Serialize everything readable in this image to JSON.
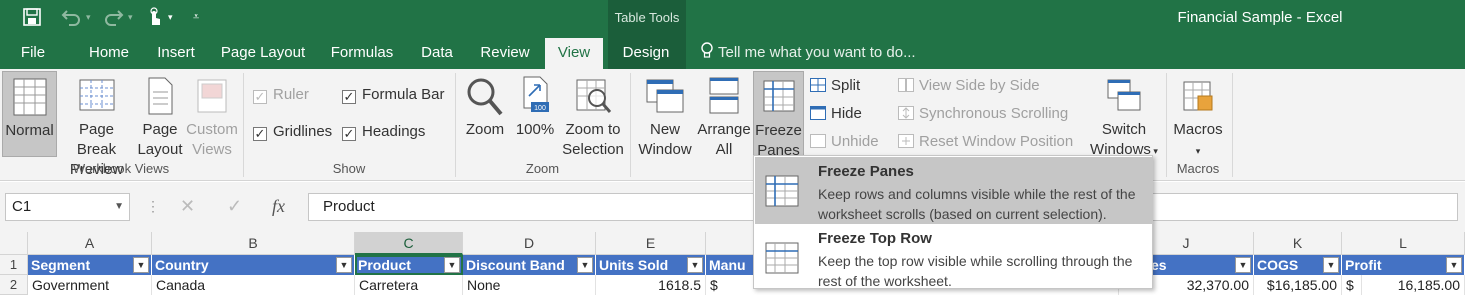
{
  "window": {
    "title": "Financial Sample - Excel",
    "contextual_group": "Table Tools"
  },
  "qat": {
    "save_icon": "save-icon",
    "undo_icon": "undo-icon",
    "redo_icon": "redo-icon",
    "touch_icon": "touch-mode-icon",
    "customize_icon": "customize-qat-icon"
  },
  "tabs": [
    {
      "label": "File"
    },
    {
      "label": "Home"
    },
    {
      "label": "Insert"
    },
    {
      "label": "Page Layout"
    },
    {
      "label": "Formulas"
    },
    {
      "label": "Data"
    },
    {
      "label": "Review"
    },
    {
      "label": "View"
    },
    {
      "label": "Design"
    }
  ],
  "tell_me": "Tell me what you want to do...",
  "ribbon": {
    "workbook_views": {
      "label": "Workbook Views",
      "normal": "Normal",
      "page_break_1": "Page Break",
      "page_break_2": "Preview",
      "page_layout_1": "Page",
      "page_layout_2": "Layout",
      "custom_1": "Custom",
      "custom_2": "Views"
    },
    "show": {
      "label": "Show",
      "ruler": "Ruler",
      "formula_bar": "Formula Bar",
      "gridlines": "Gridlines",
      "headings": "Headings",
      "ruler_checked": true,
      "formula_bar_checked": true,
      "gridlines_checked": true,
      "headings_checked": true
    },
    "zoom": {
      "label": "Zoom",
      "zoom": "Zoom",
      "zoom100": "100%",
      "zts_1": "Zoom to",
      "zts_2": "Selection"
    },
    "window": {
      "new_1": "New",
      "new_2": "Window",
      "arrange_1": "Arrange",
      "arrange_2": "All",
      "freeze_1": "Freeze",
      "freeze_2": "Panes",
      "split": "Split",
      "hide": "Hide",
      "unhide": "Unhide",
      "side_by_side": "View Side by Side",
      "sync_scroll": "Synchronous Scrolling",
      "reset_pos": "Reset Window Position",
      "switch_1": "Switch",
      "switch_2": "Windows"
    },
    "macros": {
      "label": "Macros",
      "macros": "Macros"
    }
  },
  "formula_bar": {
    "name_box": "C1",
    "cancel": "✕",
    "enter": "✓",
    "fx": "fx",
    "content": "Product"
  },
  "columns": [
    "A",
    "B",
    "C",
    "D",
    "E",
    "J",
    "K",
    "L"
  ],
  "rows": [
    "1",
    "2"
  ],
  "headers": [
    "Segment",
    "Country",
    "Product",
    "Discount Band",
    "Units Sold",
    "Manu",
    "es",
    "COGS",
    "Profit"
  ],
  "row2": [
    "Government",
    "Canada",
    "Carretera",
    "None",
    "1618.5",
    "$",
    "32,370.00",
    "$16,185.00",
    "$",
    "16,185.00"
  ],
  "freeze_menu": [
    {
      "title": "Freeze Panes",
      "desc": "Keep rows and columns visible while the rest of the worksheet scrolls (based on current selection)."
    },
    {
      "title": "Freeze Top Row",
      "desc": "Keep the top row visible while scrolling through the rest of the worksheet."
    }
  ],
  "colors": {
    "excel_green": "#217346",
    "table_header": "#4472c4",
    "highlight": "#c6c6c6"
  }
}
